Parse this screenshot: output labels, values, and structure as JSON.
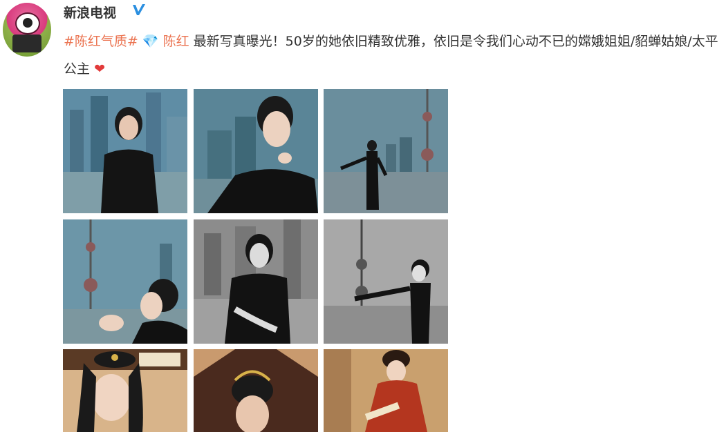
{
  "post": {
    "username": "新浪电视",
    "text": {
      "tag1": "#陈红气质#",
      "gem_icon": "diamond-icon",
      "name": "陈红",
      "body": " 最新写真曝光！50岁的她依旧精致优雅，依旧是令我们心动不已的嫦娥姐姐/貂蝉姑娘/太平公主",
      "heart_icon": "heart-icon"
    }
  },
  "colors": {
    "tag": "#eb7350",
    "verified": "#2b8fe0",
    "heart": "#e23a3a"
  }
}
